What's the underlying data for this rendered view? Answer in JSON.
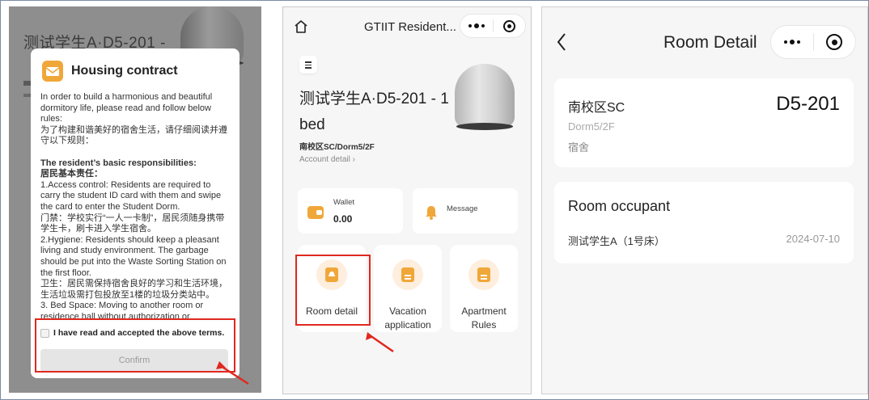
{
  "panel1": {
    "bg_title": "测试学生A·D5-201 -",
    "modal": {
      "title": "Housing contract",
      "terms": [
        {
          "text": "In order to build a harmonious and beautiful dormitory life, please read and follow below rules:",
          "bold": false
        },
        {
          "text": "为了构建和谐美好的宿舍生活，请仔细阅读并遵守以下规则：",
          "bold": false
        },
        {
          "text": "",
          "bold": false
        },
        {
          "text": "The resident’s basic responsibilities:",
          "bold": true
        },
        {
          "text": "居民基本责任：",
          "bold": true
        },
        {
          "text": "1.Access control: Residents are required to carry the student ID card with them and swipe the card to enter the Student Dorm.",
          "bold": false
        },
        {
          "text": "门禁：学校实行“一人一卡制”，居民须随身携带学生卡，刷卡进入学生宿舍。",
          "bold": false
        },
        {
          "text": "2.Hygiene: Residents should keep a pleasant living and study environment. The garbage should be put into the Waste Sorting Station on the first floor.",
          "bold": false
        },
        {
          "text": "卫生：居民需保持宿舍良好的学习和生活环境，生活垃圾需打包投放至1楼的垃圾分类站中。",
          "bold": false
        },
        {
          "text": "3. Bed Space: Moving to another room or residence hall without authorization or",
          "bold": false
        }
      ],
      "agree_label": "I have read and accepted the above terms.",
      "confirm_label": "Confirm"
    }
  },
  "panel2": {
    "app_title": "GTIIT Resident...",
    "room_title": "测试学生A·D5-201 - 1 bed",
    "campus": "南校区SC/Dorm5/2F",
    "account_link": "Account detail  ›",
    "wallet": {
      "label": "Wallet",
      "value": "0.00"
    },
    "message": {
      "label": "Message"
    },
    "tiles": [
      {
        "label": "Room detail"
      },
      {
        "label": "Vacation application"
      },
      {
        "label": "Apartment Rules"
      }
    ]
  },
  "panel3": {
    "header_title": "Room Detail",
    "campus": "南校区SC",
    "dorm": "Dorm5/2F",
    "type": "宿舍",
    "room_no": "D5-201",
    "occupant_title": "Room occupant",
    "occupant_name": "测试学生A（1号床）",
    "occupant_date": "2024-07-10"
  },
  "colors": {
    "accent": "#f0a73a",
    "highlight": "#e0281f"
  },
  "icons": [
    "envelope-icon",
    "home-icon",
    "more-icon",
    "target-icon",
    "menu-icon",
    "wallet-icon",
    "bell-icon",
    "person-card-icon",
    "clipboard-icon",
    "back-icon"
  ]
}
